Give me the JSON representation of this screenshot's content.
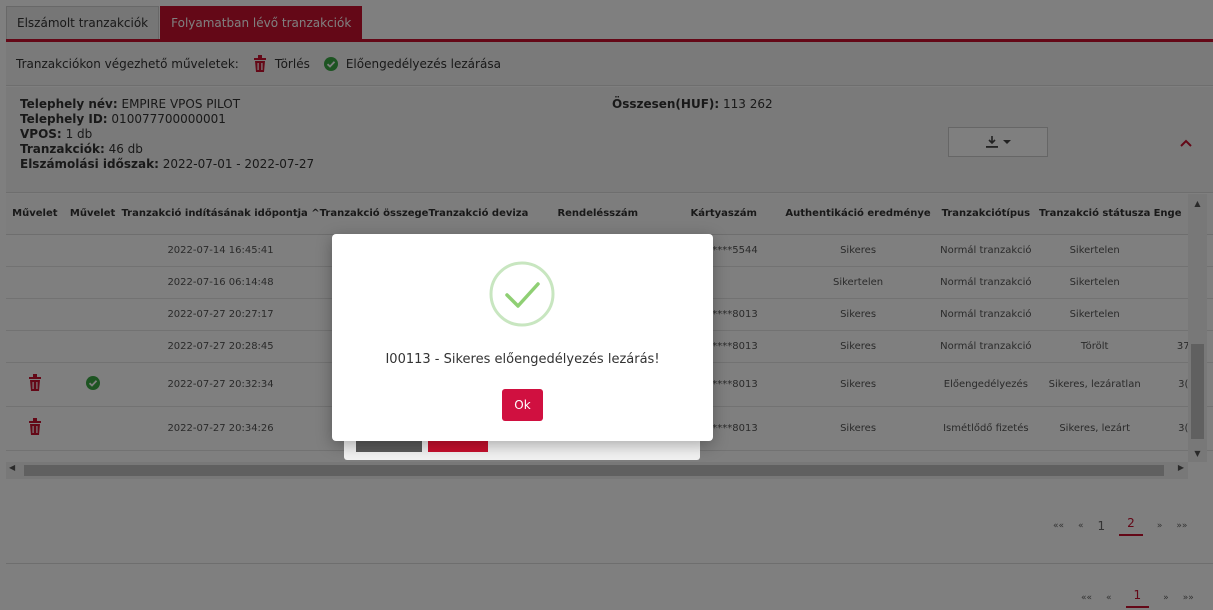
{
  "tabs": [
    "Elszámolt tranzakciók",
    "Folyamatban lévő tranzakciók"
  ],
  "operations": {
    "label": "Tranzakciókon végezhető műveletek:",
    "delete_label": "Törlés",
    "close_label": "Előengedélyezés lezárása"
  },
  "info": {
    "site_name_label": "Telephely név:",
    "site_name": "EMPIRE VPOS PILOT",
    "site_id_label": "Telephely ID:",
    "site_id": "010077700000001",
    "vpos_label": "VPOS:",
    "vpos": "1 db",
    "tx_label": "Tranzakciók:",
    "tx": "46 db",
    "period_label": "Elszámolási időszak:",
    "period": "2022-07-01 - 2022-07-27",
    "total_label": "Összesen(HUF):",
    "total": "113 262"
  },
  "table": {
    "headers": [
      "Művelet",
      "Művelet",
      "Tranzakció indításának időpontja ^",
      "Tranzakció összege",
      "Tranzakció deviza",
      "Rendelésszám",
      "Kártyaszám",
      "Authentikáció eredménye",
      "Tranzakciótípus",
      "Tranzakció státusza",
      "Enge"
    ],
    "rows": [
      {
        "del": false,
        "close": false,
        "time": "2022-07-14 16:45:41",
        "card": "31******5544",
        "auth": "Sikeres",
        "type": "Normál tranzakció",
        "status": "Sikertelen",
        "last": ""
      },
      {
        "del": false,
        "close": false,
        "time": "2022-07-16 06:14:48",
        "card": "",
        "auth": "Sikertelen",
        "type": "Normál tranzakció",
        "status": "Sikertelen",
        "last": ""
      },
      {
        "del": false,
        "close": false,
        "time": "2022-07-27 20:27:17",
        "card": "03******8013",
        "auth": "Sikeres",
        "type": "Normál tranzakció",
        "status": "Sikertelen",
        "last": ""
      },
      {
        "del": false,
        "close": false,
        "time": "2022-07-27 20:28:45",
        "card": "03******8013",
        "auth": "Sikeres",
        "type": "Normál tranzakció",
        "status": "Törölt",
        "last": "37"
      },
      {
        "del": true,
        "close": true,
        "time": "2022-07-27 20:32:34",
        "card": "03******8013",
        "auth": "Sikeres",
        "type": "Előengedélyezés",
        "status": "Sikeres, lezáratlan",
        "last": "3("
      },
      {
        "del": true,
        "close": false,
        "time": "2022-07-27 20:34:26",
        "card": "03******8013",
        "auth": "Sikeres",
        "type": "Ismétlődő fizetés",
        "status": "Sikeres, lezárt",
        "last": "3("
      }
    ]
  },
  "pager1": {
    "first": "««",
    "prev": "«",
    "pages": [
      "1",
      "2"
    ],
    "current": "2",
    "next": "»",
    "last": "»»"
  },
  "pager2": {
    "first": "««",
    "prev": "«",
    "pages": [
      "1"
    ],
    "current": "1",
    "next": "»",
    "last": "»»"
  },
  "modal": {
    "message": "I00113 - Sikeres előengedélyezés lezárás!",
    "ok_label": "Ok"
  },
  "colors": {
    "accent": "#c8102e",
    "success": "#3aa845",
    "overlay": "rgba(0,0,0,0.5)"
  }
}
